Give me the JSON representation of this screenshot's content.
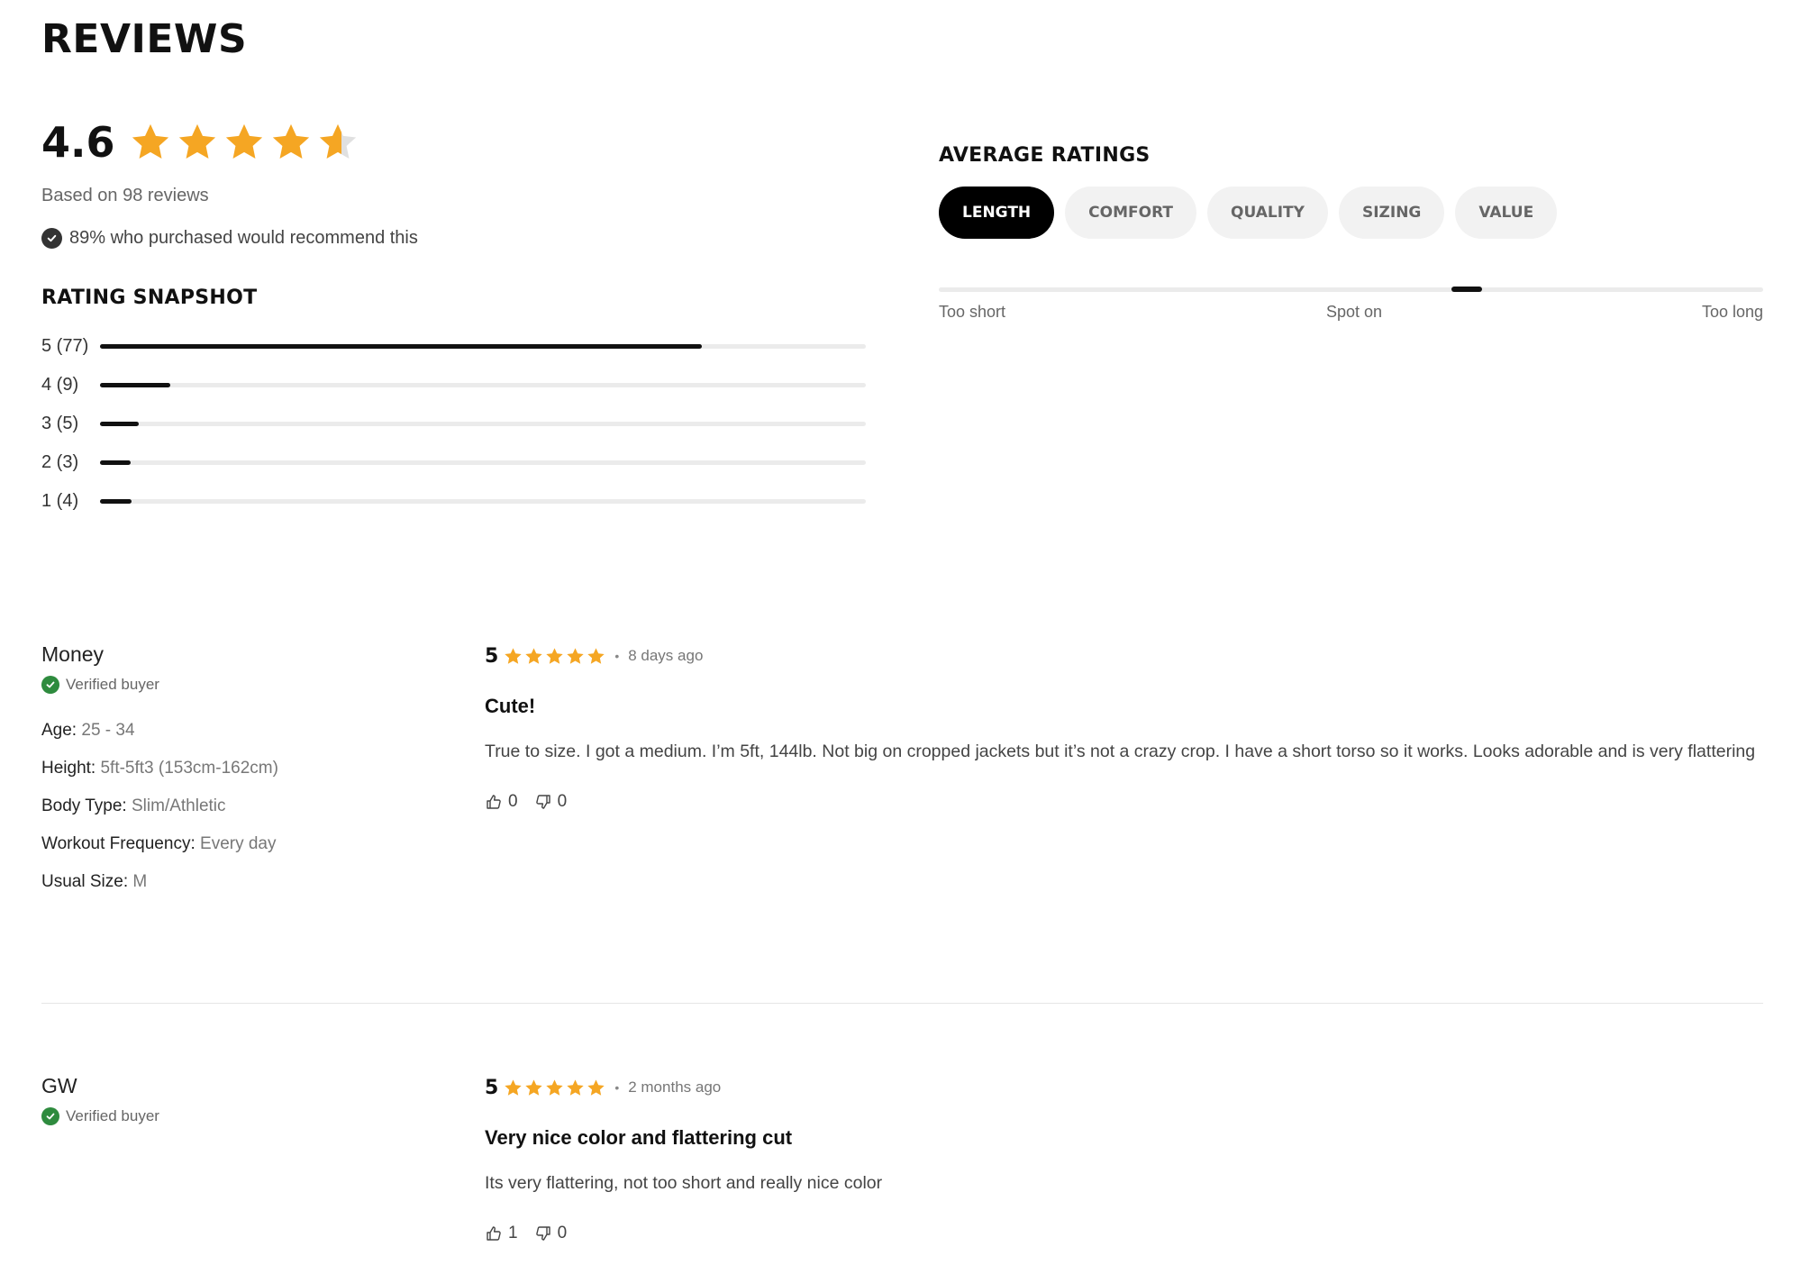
{
  "page": {
    "title": "REVIEWS"
  },
  "summary": {
    "score": "4.6",
    "stars_filled_fraction": 0.92,
    "based_on": "Based on 98 reviews",
    "recommend_text": "89% who purchased would recommend this",
    "star_color": "#f5a623"
  },
  "snapshot": {
    "title": "RATING SNAPSHOT",
    "rows": [
      {
        "label": "5 (77)",
        "count": 77
      },
      {
        "label": "4 (9)",
        "count": 9
      },
      {
        "label": "3 (5)",
        "count": 5
      },
      {
        "label": "2 (3)",
        "count": 3
      },
      {
        "label": "1 (4)",
        "count": 4
      }
    ]
  },
  "average_ratings": {
    "title": "AVERAGE RATINGS",
    "tabs": [
      "LENGTH",
      "COMFORT",
      "QUALITY",
      "SIZING",
      "VALUE"
    ],
    "active_tab": 0,
    "scale_value_fraction": 0.64,
    "scale_labels": {
      "left": "Too short",
      "middle": "Spot on",
      "right": "Too long"
    }
  },
  "reviews": [
    {
      "name": "Money",
      "verified": "Verified buyer",
      "attributes": [
        {
          "label": "Age:",
          "value": "25 - 34"
        },
        {
          "label": "Height:",
          "value": "5ft-5ft3 (153cm-162cm)"
        },
        {
          "label": "Body Type:",
          "value": "Slim/Athletic"
        },
        {
          "label": "Workout Frequency:",
          "value": "Every day"
        },
        {
          "label": "Usual Size:",
          "value": "M"
        }
      ],
      "rating": "5",
      "date": "8 days ago",
      "title": "Cute!",
      "body": "True to size. I got a medium. I’m 5ft, 144lb. Not big on cropped jackets but it’s not a crazy crop. I have a short torso so it works. Looks adorable and is very flattering",
      "helpful_yes": "0",
      "helpful_no": "0"
    },
    {
      "name": "GW",
      "verified": "Verified buyer",
      "attributes": [],
      "rating": "5",
      "date": "2 months ago",
      "title": "Very nice color and flattering cut",
      "body": "Its very flattering, not too short and really nice color",
      "helpful_yes": "1",
      "helpful_no": "0"
    }
  ]
}
